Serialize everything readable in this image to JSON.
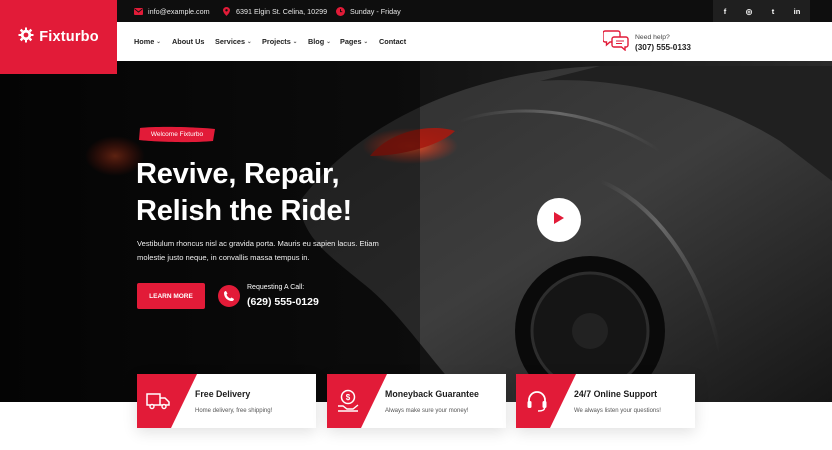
{
  "topbar": {
    "email": "info@example.com",
    "address": "6391 Elgin St. Celina, 10299",
    "hours": "Sunday - Friday",
    "socials": [
      {
        "icon": "facebook-icon",
        "glyph": "f"
      },
      {
        "icon": "instagram-icon",
        "glyph": "◎"
      },
      {
        "icon": "twitter-icon",
        "glyph": "t"
      },
      {
        "icon": "linkedin-icon",
        "glyph": "in"
      }
    ]
  },
  "brand": {
    "name": "Fixturbo",
    "color": "#e21b38"
  },
  "nav": {
    "items": [
      {
        "label": "Home",
        "dropdown": true
      },
      {
        "label": "About Us",
        "dropdown": false
      },
      {
        "label": "Services",
        "dropdown": true
      },
      {
        "label": "Projects",
        "dropdown": true
      },
      {
        "label": "Blog",
        "dropdown": true
      },
      {
        "label": "Pages",
        "dropdown": true
      },
      {
        "label": "Contact",
        "dropdown": false
      }
    ],
    "help_label": "Need help?",
    "help_phone": "(307) 555-0133"
  },
  "hero": {
    "badge": "Welcome Fixturbo",
    "title_line1": "Revive, Repair,",
    "title_line2": "Relish the Ride!",
    "description": "Vestibulum rhoncus nisl ac gravida porta. Mauris eu sapien lacus. Etiam molestie justo neque, in convallis massa tempus in.",
    "cta_label": "LEARN MORE",
    "call_label": "Requesting A Call:",
    "call_phone": "(629) 555-0129"
  },
  "features": [
    {
      "title": "Free Delivery",
      "subtitle": "Home delivery, free shipping!",
      "icon": "truck-icon"
    },
    {
      "title": "Moneyback Guarantee",
      "subtitle": "Always make sure your money!",
      "icon": "money-hand-icon"
    },
    {
      "title": "24/7 Online Support",
      "subtitle": "We always listen your questions!",
      "icon": "headset-icon"
    }
  ]
}
